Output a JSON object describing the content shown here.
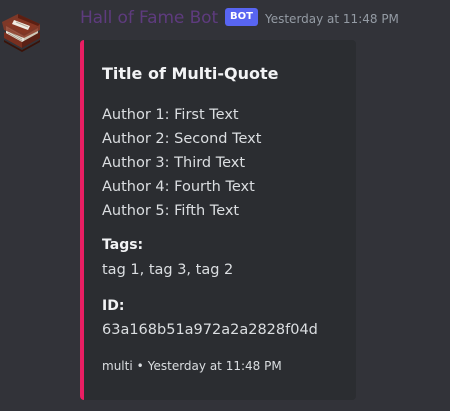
{
  "message": {
    "username": "Hall of Fame Bot",
    "badge": "BOT",
    "timestamp": "Yesterday at 11:48 PM",
    "avatar_icon": "book-icon",
    "username_color": "#5e3b7e"
  },
  "embed": {
    "accent_color": "#e91e63",
    "title": "Title of Multi-Quote",
    "quotes": [
      "Author 1: First Text",
      "Author 2: Second Text",
      "Author 3: Third Text",
      "Author 4: Fourth Text",
      "Author 5: Fifth Text"
    ],
    "fields": {
      "tags": {
        "name": "Tags:",
        "value": "tag 1, tag 3, tag 2"
      },
      "id": {
        "name": "ID:",
        "value": "63a168b51a972a2a2828f04d"
      }
    },
    "footer": {
      "text": "multi",
      "separator": "•",
      "timestamp": "Yesterday at 11:48 PM"
    }
  }
}
